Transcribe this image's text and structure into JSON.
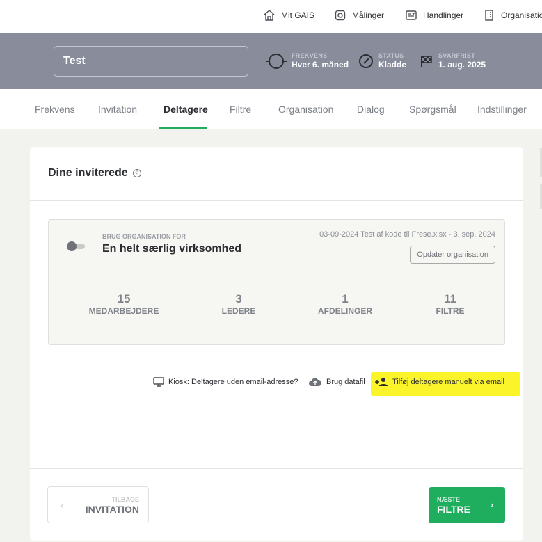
{
  "topnav": {
    "items": [
      {
        "label": "Mit GAIS",
        "icon": "home-icon"
      },
      {
        "label": "Målinger",
        "icon": "measurements-icon"
      },
      {
        "label": "Handlinger",
        "icon": "actions-icon"
      },
      {
        "label": "Organisation",
        "icon": "building-icon"
      }
    ]
  },
  "header": {
    "title": "Test",
    "frequency": {
      "label": "FREKVENS",
      "value": "Hver 6. måned"
    },
    "status": {
      "label": "STATUS",
      "value": "Kladde"
    },
    "deadline": {
      "label": "SVARFRIST",
      "value": "1. aug. 2025"
    }
  },
  "tabs": [
    "Frekvens",
    "Invitation",
    "Deltagere",
    "Filtre",
    "Organisation",
    "Dialog",
    "Spørgsmål",
    "Indstillinger"
  ],
  "active_tab": "Deltagere",
  "section": {
    "title": "Dine inviterede",
    "help_glyph": "?"
  },
  "organisation": {
    "use_label": "BRUG ORGANISATION FOR",
    "name": "En helt særlig virksomhed",
    "file_info": "03-09-2024 Test af kode til Frese.xlsx - 3. sep. 2024",
    "update_button": "Opdater organisation",
    "stats": [
      {
        "value": "15",
        "label": "MEDARBEJDERE"
      },
      {
        "value": "3",
        "label": "LEDERE"
      },
      {
        "value": "1",
        "label": "AFDELINGER"
      },
      {
        "value": "11",
        "label": "FILTRE"
      }
    ]
  },
  "links": {
    "kiosk": "Kiosk: Deltagere uden email-adresse?",
    "datafile": "Brug datafil",
    "manual": "Tilføj deltagere manuelt via email"
  },
  "footer": {
    "back": {
      "small": "TILBAGE",
      "big": "INVITATION"
    },
    "next": {
      "small": "NÆSTE",
      "big": "FILTRE"
    }
  },
  "colors": {
    "accent": "#1fae5e",
    "header_bg": "#888c9b",
    "highlight": "#fbf42b"
  }
}
